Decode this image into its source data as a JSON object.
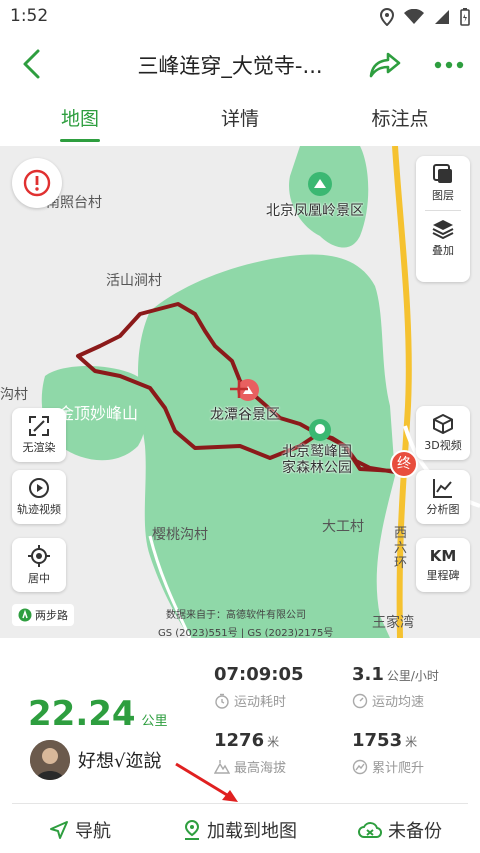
{
  "status_bar": {
    "time": "1:52"
  },
  "header": {
    "title": "三峰连穿_大觉寺-..."
  },
  "tabs": [
    {
      "label": "地图",
      "active": true
    },
    {
      "label": "详情",
      "active": false
    },
    {
      "label": "标注点",
      "active": false
    }
  ],
  "map": {
    "places": {
      "nanzhaotai": "南照台村",
      "fenghuangling": "北京凤凰岭景区",
      "huoshanjian": "活山涧村",
      "gou": "沟村",
      "miaofengshan": "金顶妙峰山",
      "longtangu": "龙潭谷景区",
      "jiufeng": "北京鹫峰国家森林公园",
      "yingtaogou": "樱桃沟村",
      "dagong": "大工村",
      "wangjiawan": "王家湾",
      "xiliuhuan": "西六环"
    },
    "end_marker": "终",
    "credit_line1": "数据来自于：高德软件有限公司",
    "credit_line2": "GS (2023)551号 | GS (2023)2175号",
    "two_step_label": "两步路",
    "buttons": {
      "layers": "图层",
      "overlay": "叠加",
      "no_render": "无渲染",
      "track_video": "轨迹视频",
      "center": "居中",
      "video3d": "3D视频",
      "analysis": "分析图",
      "km_top": "KM",
      "milestone": "里程碑"
    }
  },
  "stats": {
    "distance": "22.24",
    "distance_unit": "公里",
    "user_name": "好想√迩說",
    "duration": {
      "value": "07:09:05",
      "label": "运动耗时"
    },
    "avg_speed": {
      "value": "3.1",
      "unit": "公里/小时",
      "label": "运动均速"
    },
    "max_altitude": {
      "value": "1276",
      "unit": "米",
      "label": "最高海拔"
    },
    "total_climb": {
      "value": "1753",
      "unit": "米",
      "label": "累计爬升"
    }
  },
  "bottom_bar": {
    "navigate": "导航",
    "load_to_map": "加载到地图",
    "backup": "未备份"
  },
  "colors": {
    "accent": "#2e9e3f",
    "map_green": "#8fd8a8",
    "track": "#8b1a1a",
    "arrow": "#e02020"
  }
}
